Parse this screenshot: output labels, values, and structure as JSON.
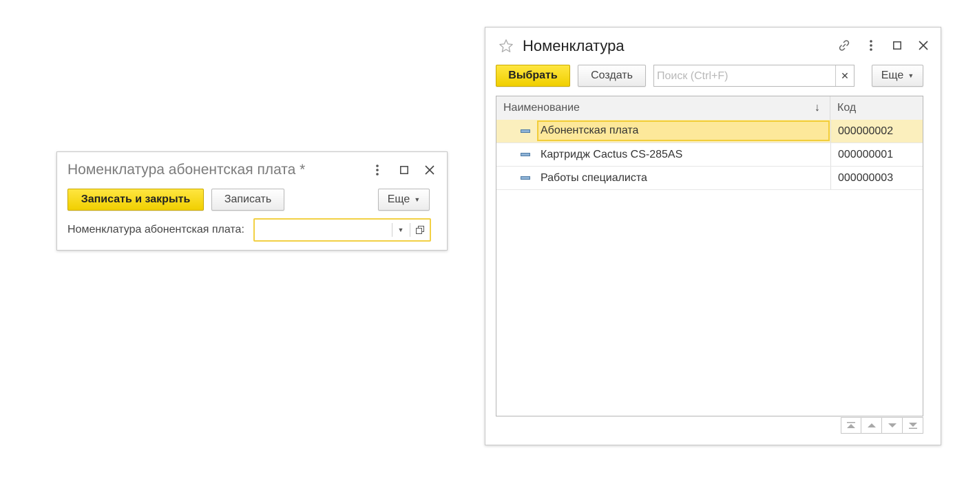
{
  "left_window": {
    "title": "Номенклатура абонентская плата *",
    "buttons": {
      "save_close": "Записать и закрыть",
      "save": "Записать",
      "more": "Еще"
    },
    "field": {
      "label": "Номенклатура абонентская плата:",
      "value": ""
    },
    "icons": [
      "more-vert-icon",
      "maximize-icon",
      "close-icon",
      "dropdown-icon",
      "open-form-icon"
    ]
  },
  "right_window": {
    "title": "Номенклатура",
    "buttons": {
      "select": "Выбрать",
      "create": "Создать",
      "more": "Еще"
    },
    "search": {
      "placeholder": "Поиск (Ctrl+F)",
      "value": ""
    },
    "table": {
      "columns": [
        "Наименование",
        "Код"
      ],
      "sort_indicator": "↓",
      "rows": [
        {
          "name": "Абонентская плата",
          "code": "000000002",
          "selected": true
        },
        {
          "name": "Картридж Cactus CS-285AS",
          "code": "000000001",
          "selected": false
        },
        {
          "name": "Работы специалиста",
          "code": "000000003",
          "selected": false
        }
      ]
    },
    "icons": [
      "star-icon",
      "link-icon",
      "more-vert-icon",
      "maximize-icon",
      "close-icon",
      "clear-icon",
      "first-page-icon",
      "prev-icon",
      "next-icon",
      "last-page-icon"
    ]
  },
  "colors": {
    "primary_button": "#f5d80f",
    "selection_row": "#fbefbd",
    "focus_border": "#f2cd3a"
  }
}
